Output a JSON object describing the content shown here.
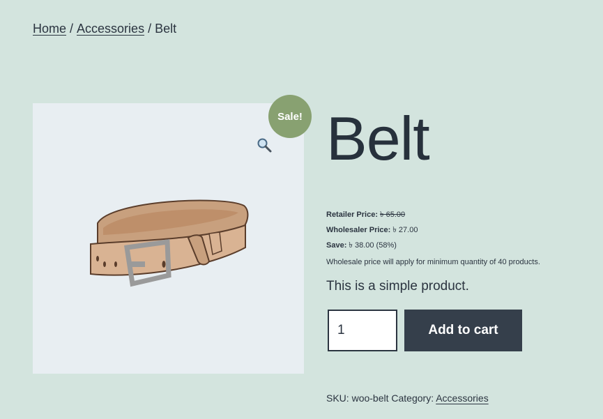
{
  "breadcrumb": {
    "home": "Home",
    "category": "Accessories",
    "current": "Belt",
    "separator": "/"
  },
  "sale_badge": "Sale!",
  "product": {
    "title": "Belt",
    "retailer_label": "Retailer Price:",
    "retailer_value": "৳ 65.00",
    "wholesaler_label": "Wholesaler Price:",
    "wholesaler_value": "৳ 27.00",
    "save_label": "Save:",
    "save_value": "৳ 38.00 (58%)",
    "notice": "Wholesale price will apply for minimum quantity of 40 products.",
    "short_description": "This is a simple product.",
    "quantity": "1",
    "add_to_cart": "Add to cart",
    "sku_label": "SKU:",
    "sku_value": "woo-belt",
    "category_label": "Category:",
    "category_value": "Accessories"
  },
  "icons": {
    "zoom": "magnifier-icon"
  },
  "colors": {
    "background": "#d3e4de",
    "sale_badge": "#88a171",
    "button": "#353f4b",
    "image_bg": "#e8eef2"
  }
}
